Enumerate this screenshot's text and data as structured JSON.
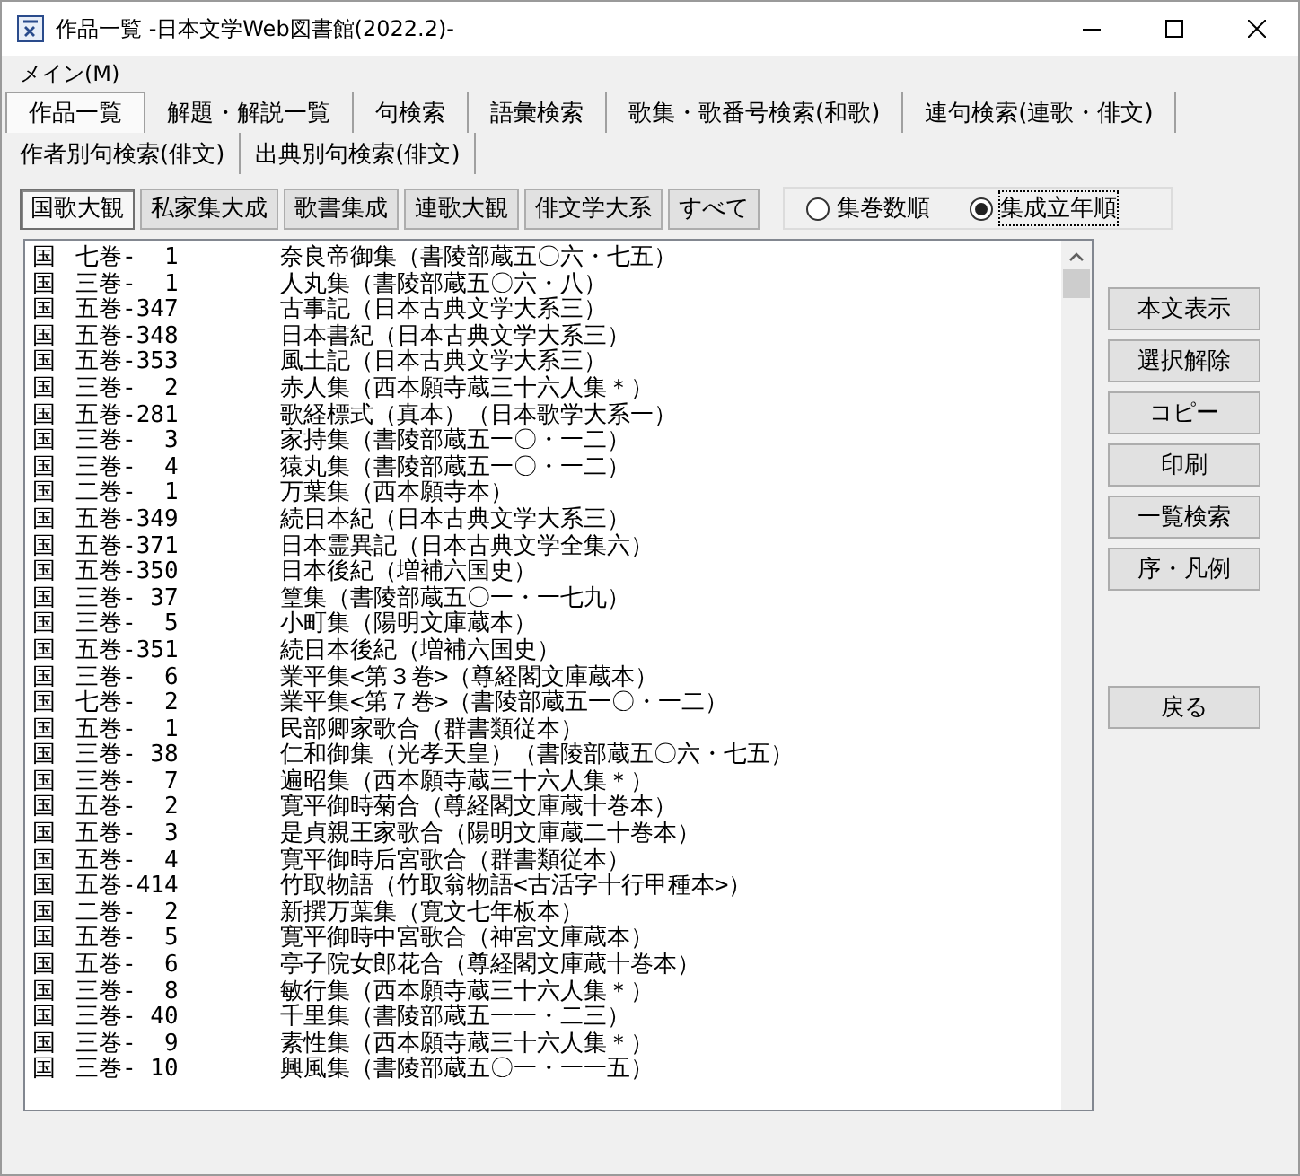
{
  "window": {
    "title": "作品一覧 -日本文学Web図書館(2022.2)-"
  },
  "menu": [
    {
      "label": "メイン(M)"
    }
  ],
  "tab_rows": [
    [
      {
        "label": "作品一覧",
        "selected": true
      },
      {
        "label": "解題・解説一覧",
        "selected": false
      },
      {
        "label": "句検索",
        "selected": false
      },
      {
        "label": "語彙検索",
        "selected": false
      },
      {
        "label": "歌集・歌番号検索(和歌)",
        "selected": false
      },
      {
        "label": "連句検索(連歌・俳文)",
        "selected": false
      }
    ],
    [
      {
        "label": "作者別句検索(俳文)",
        "selected": false
      },
      {
        "label": "出典別句検索(俳文)",
        "selected": false
      }
    ]
  ],
  "collections": [
    {
      "label": "国歌大観",
      "selected": true
    },
    {
      "label": "私家集大成",
      "selected": false
    },
    {
      "label": "歌書集成",
      "selected": false
    },
    {
      "label": "連歌大観",
      "selected": false
    },
    {
      "label": "俳文学大系",
      "selected": false
    },
    {
      "label": "すべて",
      "selected": false
    }
  ],
  "sort_options": [
    {
      "label": "集巻数順",
      "selected": false
    },
    {
      "label": "集成立年順",
      "selected": true
    }
  ],
  "list": [
    {
      "source": "国",
      "volume": "七巻-  1",
      "title": "奈良帝御集（書陵部蔵五〇六・七五）"
    },
    {
      "source": "国",
      "volume": "三巻-  1",
      "title": "人丸集（書陵部蔵五〇六・八）"
    },
    {
      "source": "国",
      "volume": "五巻-347",
      "title": "古事記（日本古典文学大系三）"
    },
    {
      "source": "国",
      "volume": "五巻-348",
      "title": "日本書紀（日本古典文学大系三）"
    },
    {
      "source": "国",
      "volume": "五巻-353",
      "title": "風土記（日本古典文学大系三）"
    },
    {
      "source": "国",
      "volume": "三巻-  2",
      "title": "赤人集（西本願寺蔵三十六人集＊）"
    },
    {
      "source": "国",
      "volume": "五巻-281",
      "title": "歌経標式（真本）（日本歌学大系一）"
    },
    {
      "source": "国",
      "volume": "三巻-  3",
      "title": "家持集（書陵部蔵五一〇・一二）"
    },
    {
      "source": "国",
      "volume": "三巻-  4",
      "title": "猿丸集（書陵部蔵五一〇・一二）"
    },
    {
      "source": "国",
      "volume": "二巻-  1",
      "title": "万葉集（西本願寺本）"
    },
    {
      "source": "国",
      "volume": "五巻-349",
      "title": "続日本紀（日本古典文学大系三）"
    },
    {
      "source": "国",
      "volume": "五巻-371",
      "title": "日本霊異記（日本古典文学全集六）"
    },
    {
      "source": "国",
      "volume": "五巻-350",
      "title": "日本後紀（増補六国史）"
    },
    {
      "source": "国",
      "volume": "三巻- 37",
      "title": "篁集（書陵部蔵五〇一・一七九）"
    },
    {
      "source": "国",
      "volume": "三巻-  5",
      "title": "小町集（陽明文庫蔵本）"
    },
    {
      "source": "国",
      "volume": "五巻-351",
      "title": "続日本後紀（増補六国史）"
    },
    {
      "source": "国",
      "volume": "三巻-  6",
      "title": "業平集<第３巻>（尊経閣文庫蔵本）"
    },
    {
      "source": "国",
      "volume": "七巻-  2",
      "title": "業平集<第７巻>（書陵部蔵五一〇・一二）"
    },
    {
      "source": "国",
      "volume": "五巻-  1",
      "title": "民部卿家歌合（群書類従本）"
    },
    {
      "source": "国",
      "volume": "三巻- 38",
      "title": "仁和御集（光孝天皇）（書陵部蔵五〇六・七五）"
    },
    {
      "source": "国",
      "volume": "三巻-  7",
      "title": "遍昭集（西本願寺蔵三十六人集＊）"
    },
    {
      "source": "国",
      "volume": "五巻-  2",
      "title": "寛平御時菊合（尊経閣文庫蔵十巻本）"
    },
    {
      "source": "国",
      "volume": "五巻-  3",
      "title": "是貞親王家歌合（陽明文庫蔵二十巻本）"
    },
    {
      "source": "国",
      "volume": "五巻-  4",
      "title": "寛平御時后宮歌合（群書類従本）"
    },
    {
      "source": "国",
      "volume": "五巻-414",
      "title": "竹取物語（竹取翁物語<古活字十行甲種本>）"
    },
    {
      "source": "国",
      "volume": "二巻-  2",
      "title": "新撰万葉集（寛文七年板本）"
    },
    {
      "source": "国",
      "volume": "五巻-  5",
      "title": "寛平御時中宮歌合（神宮文庫蔵本）"
    },
    {
      "source": "国",
      "volume": "五巻-  6",
      "title": "亭子院女郎花合（尊経閣文庫蔵十巻本）"
    },
    {
      "source": "国",
      "volume": "三巻-  8",
      "title": "敏行集（西本願寺蔵三十六人集＊）"
    },
    {
      "source": "国",
      "volume": "三巻- 40",
      "title": "千里集（書陵部蔵五一一・二三）"
    },
    {
      "source": "国",
      "volume": "三巻-  9",
      "title": "素性集（西本願寺蔵三十六人集＊）"
    },
    {
      "source": "国",
      "volume": "三巻- 10",
      "title": "興風集（書陵部蔵五〇一・一一五）"
    }
  ],
  "actions": [
    {
      "label": "本文表示"
    },
    {
      "label": "選択解除"
    },
    {
      "label": "コピー"
    },
    {
      "label": "印刷"
    },
    {
      "label": "一覧検索"
    },
    {
      "label": "序・凡例"
    }
  ],
  "back_button": {
    "label": "戻る"
  }
}
